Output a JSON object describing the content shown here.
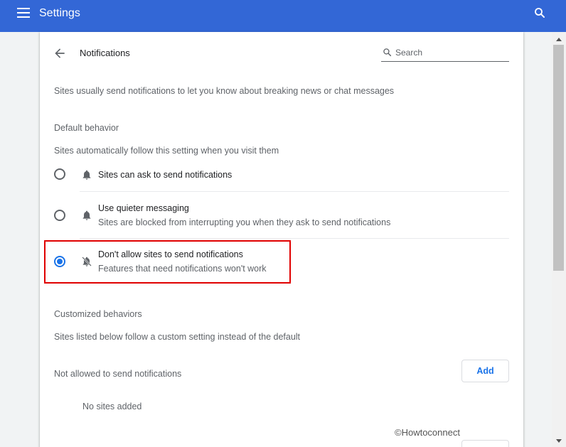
{
  "topbar": {
    "title": "Settings",
    "menu_icon": "hamburger-menu-icon",
    "search_icon": "search-icon",
    "color": "#3367d6"
  },
  "page": {
    "title": "Notifications",
    "search_placeholder": "Search",
    "description": "Sites usually send notifications to let you know about breaking news or chat messages"
  },
  "default_behavior": {
    "heading": "Default behavior",
    "subtitle": "Sites automatically follow this setting when you visit them",
    "options": [
      {
        "label": "Sites can ask to send notifications",
        "sub": "",
        "icon": "bell-icon",
        "selected": false
      },
      {
        "label": "Use quieter messaging",
        "sub": "Sites are blocked from interrupting you when they ask to send notifications",
        "icon": "bell-icon",
        "selected": false
      },
      {
        "label": "Don't allow sites to send notifications",
        "sub": "Features that need notifications won't work",
        "icon": "bell-off-icon",
        "selected": true
      }
    ]
  },
  "customized": {
    "heading": "Customized behaviors",
    "subtitle": "Sites listed below follow a custom setting instead of the default",
    "not_allowed_label": "Not allowed to send notifications",
    "add_label": "Add",
    "empty_text": "No sites added"
  },
  "watermark": "©Howtoconnect",
  "colors": {
    "accent": "#1a73e8",
    "highlight": "#e00000"
  }
}
